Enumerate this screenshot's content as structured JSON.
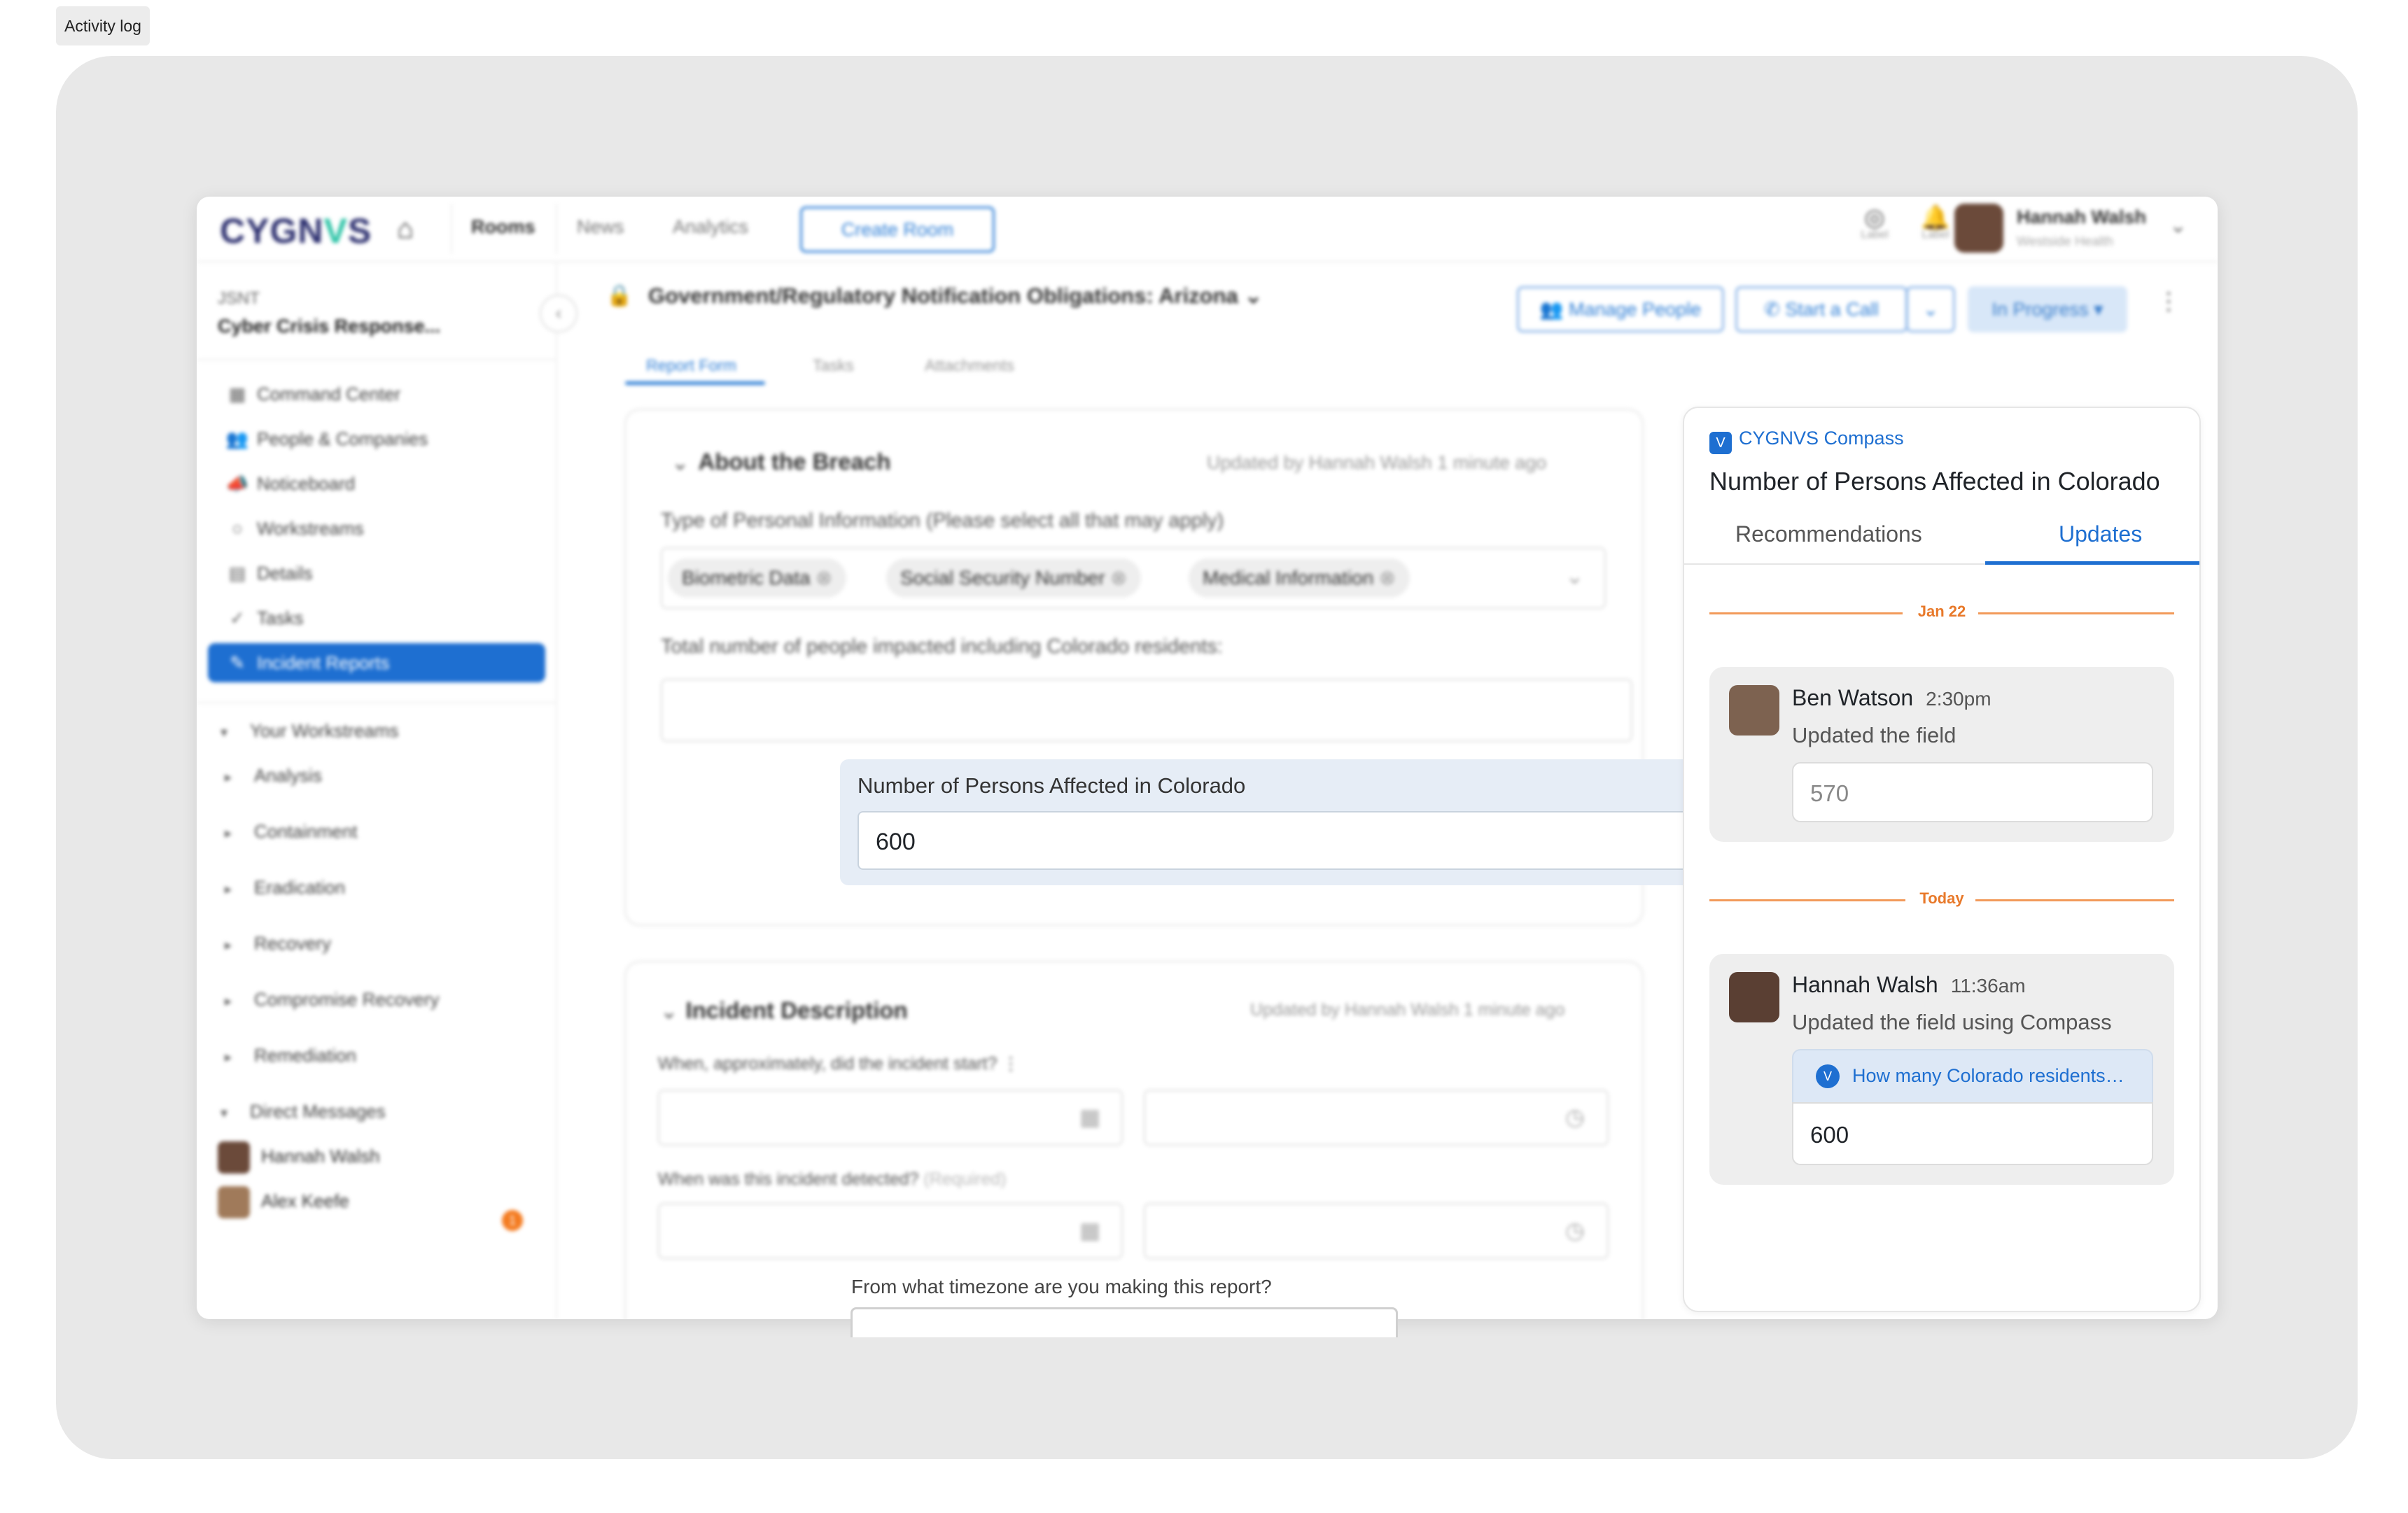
{
  "activity_tag": "Activity log",
  "app": {
    "brand": {
      "prefix": "CYGN",
      "mark": "V",
      "suffix": "S"
    },
    "topbar": {
      "nav": [
        {
          "label": "Rooms"
        },
        {
          "label": "News"
        },
        {
          "label": "Analytics"
        }
      ],
      "create_room": "Create Room",
      "icons": [
        {
          "label": "Label"
        },
        {
          "label": "Label"
        }
      ],
      "user": {
        "name": "Hannah Walsh",
        "org": "Westside Health"
      }
    },
    "sidebar": {
      "room_code": "JSNT",
      "room_name": "Cyber Crisis Response...",
      "items": [
        {
          "label": "Command Center"
        },
        {
          "label": "People & Companies"
        },
        {
          "label": "Noticeboard"
        },
        {
          "label": "Workstreams"
        },
        {
          "label": "Details"
        },
        {
          "label": "Tasks"
        },
        {
          "label": "Incident Reports"
        }
      ],
      "your_workstreams": "Your Workstreams",
      "workstreams": [
        "Analysis",
        "Containment",
        "Eradication",
        "Recovery",
        "Compromise Recovery",
        "Remediation"
      ],
      "direct_messages": "Direct Messages",
      "dms": [
        {
          "name": "Hannah Walsh",
          "badge": "1"
        },
        {
          "name": "Alex Keefe"
        }
      ]
    },
    "main": {
      "title": "Government/Regulatory Notification Obligations: Arizona",
      "manage_people": "Manage People",
      "start_call": "Start a Call",
      "status": "In Progress",
      "tabs": [
        {
          "label": "Report Form"
        },
        {
          "label": "Tasks"
        },
        {
          "label": "Attachments"
        }
      ],
      "breach": {
        "title": "About the Breach",
        "meta": "Updated by Hannah Walsh 1 minute ago",
        "type_label": "Type of Personal Information (Please select all that may apply)",
        "chips": [
          "Biometric Data",
          "Social Security Number",
          "Medical Information"
        ],
        "total_label": "Total number of people impacted including Colorado residents:",
        "highlight_label": "Number of Persons Affected in Colorado",
        "highlight_value": "600"
      },
      "incident": {
        "title": "Incident Description",
        "meta": "Updated by Hannah Walsh 1 minute ago",
        "q_start": "When, approximately, did the incident start?",
        "q_detected": "When was this incident detected?",
        "required": "(Required)",
        "q_timezone": "From what timezone are you making this report?"
      }
    },
    "compass": {
      "brand": "CYGNVS Compass",
      "title": "Number of Persons Affected in Colorado",
      "tabs": {
        "recommendations": "Recommendations",
        "updates": "Updates"
      },
      "groups": [
        {
          "date": "Jan 22",
          "name": "Ben Watson",
          "time": "2:30pm",
          "desc": "Updated the field",
          "value": "570"
        },
        {
          "date": "Today",
          "name": "Hannah Walsh",
          "time": "11:36am",
          "desc": "Updated the field using Compass",
          "question": "How many Colorado residents…",
          "value": "600"
        }
      ]
    },
    "colors": {
      "accent": "#1e6fd1",
      "date_line": "#e8792a",
      "highlight_bg": "#e6edf6",
      "notify_badge": "#f47b20"
    }
  }
}
